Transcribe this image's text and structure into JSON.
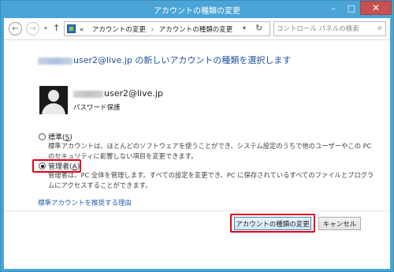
{
  "window": {
    "title": "アカウントの種類の変更",
    "minimize_glyph": "–",
    "maximize_glyph": "□",
    "close_glyph": "✕"
  },
  "nav": {
    "back_glyph": "←",
    "forward_glyph": "→",
    "history_glyph": "▾",
    "up_glyph": "↑",
    "breadcrumb_prefix": "«",
    "breadcrumbs": [
      "アカウントの変更",
      "アカウントの種類の変更"
    ],
    "breadcrumb_separator": "›",
    "address_dropdown_glyph": "▾",
    "refresh_glyph": "↻",
    "search_placeholder": "コントロール パネルの検索",
    "search_glyph": "⌕"
  },
  "content": {
    "heading_suffix": "user2@live.jp の新しいアカウントの種類を選択します",
    "account_name_suffix": "user2@live.jp",
    "account_status": "パスワード保護",
    "options": [
      {
        "label_prefix": "標準(",
        "label_key": "S",
        "label_suffix": ")",
        "description": "標準アカウントは、ほとんどのソフトウェアを使うことができ、システム設定のうちで他のユーザーやこの PC のセキュリティに影響しない項目を変更できます。",
        "selected": false
      },
      {
        "label_prefix": "管理者(",
        "label_key": "A",
        "label_suffix": ")",
        "description": "管理者は、PC 全体を管理します。すべての設定を変更でき、PC に保存されているすべてのファイルとプログラムにアクセスすることができます。",
        "selected": true
      }
    ],
    "link": "標準アカウントを推奨する理由"
  },
  "buttons": {
    "primary": "アカウントの種類の変更",
    "cancel": "キャンセル"
  },
  "colors": {
    "titlebar": "#4aa5d6",
    "close_button": "#c75050",
    "heading": "#1f4e9c",
    "link": "#1f5fb0",
    "highlight_box": "#e0001b"
  }
}
